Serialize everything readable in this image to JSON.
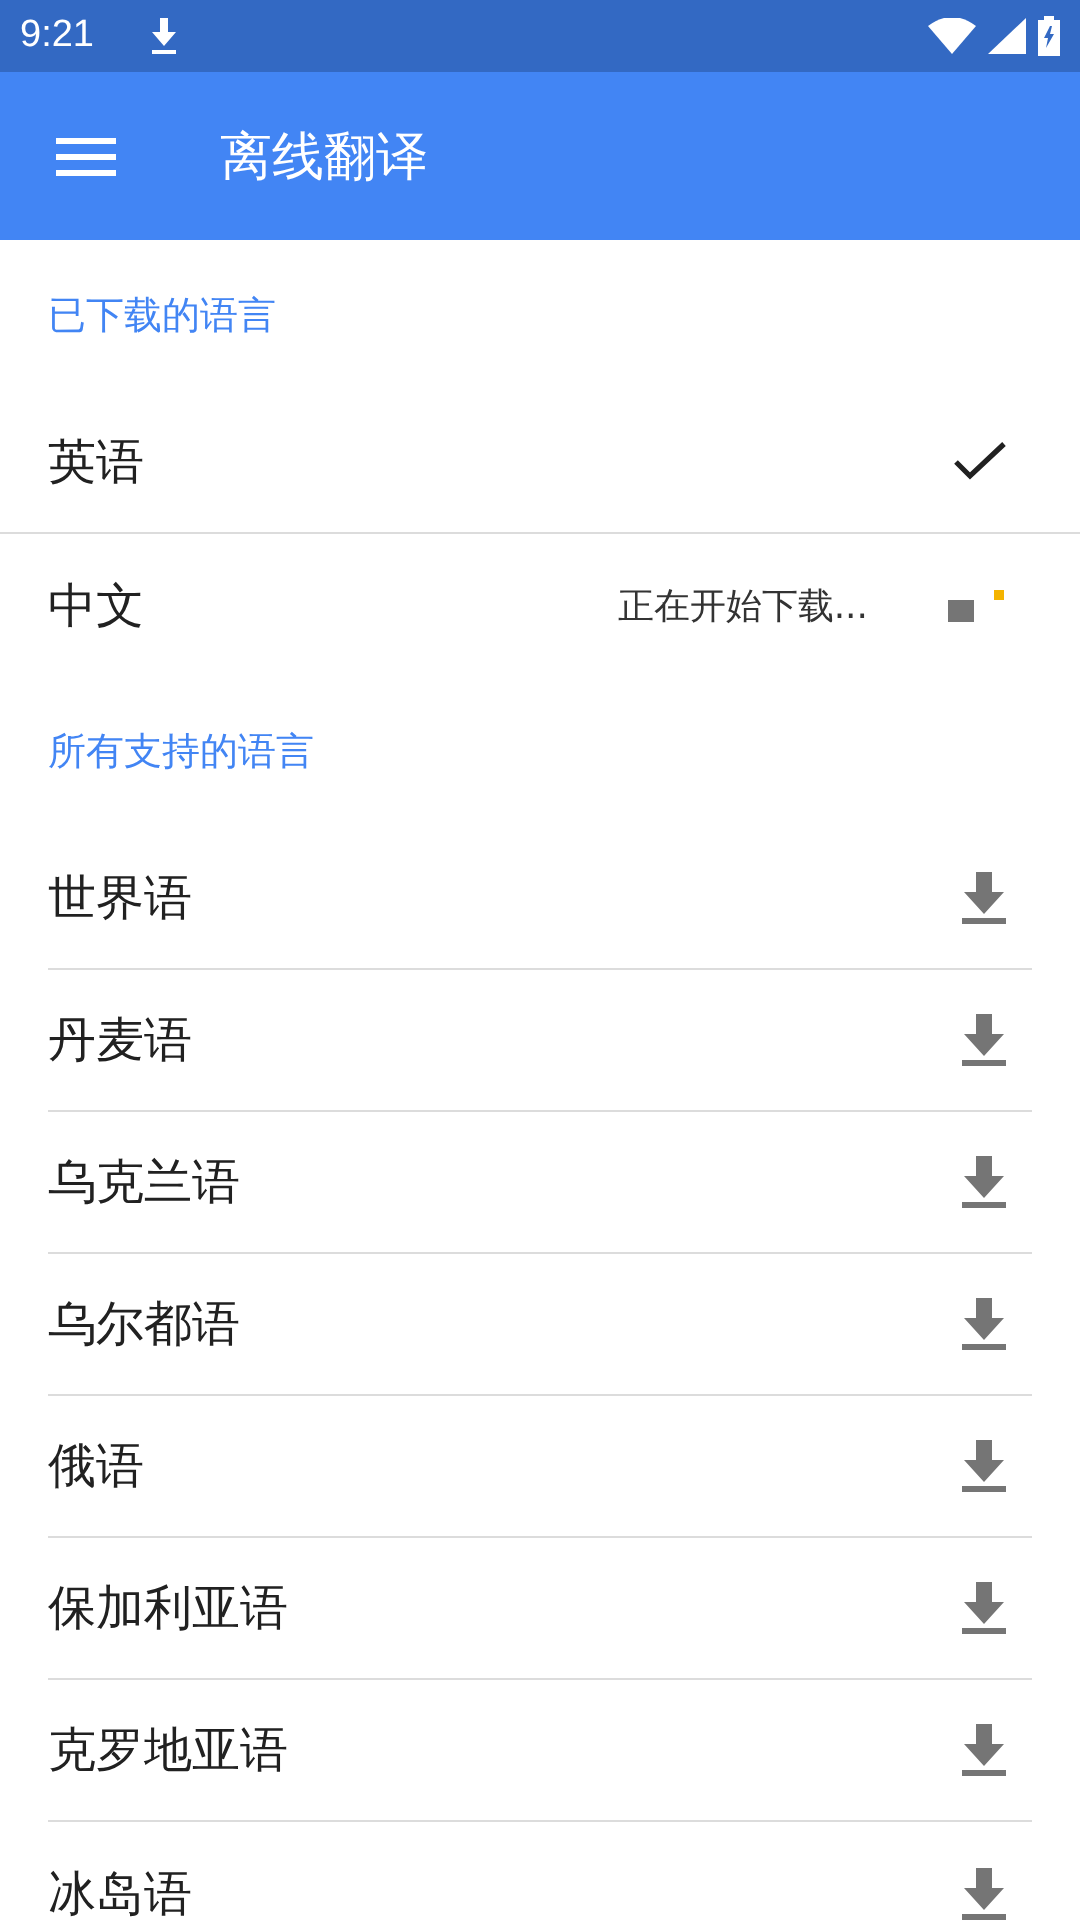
{
  "status_bar": {
    "time": "9:21"
  },
  "app_bar": {
    "title": "离线翻译"
  },
  "sections": [
    {
      "title": "已下载的语言",
      "items": [
        {
          "name": "英语",
          "kind": "downloaded"
        },
        {
          "name": "中文",
          "kind": "downloading",
          "status": "正在开始下载..."
        }
      ]
    },
    {
      "title": "所有支持的语言",
      "items": [
        {
          "name": "世界语",
          "kind": "available"
        },
        {
          "name": "丹麦语",
          "kind": "available"
        },
        {
          "name": "乌克兰语",
          "kind": "available"
        },
        {
          "name": "乌尔都语",
          "kind": "available"
        },
        {
          "name": "俄语",
          "kind": "available"
        },
        {
          "name": "保加利亚语",
          "kind": "available"
        },
        {
          "name": "克罗地亚语",
          "kind": "available"
        },
        {
          "name": "冰岛语",
          "kind": "available"
        }
      ]
    }
  ]
}
